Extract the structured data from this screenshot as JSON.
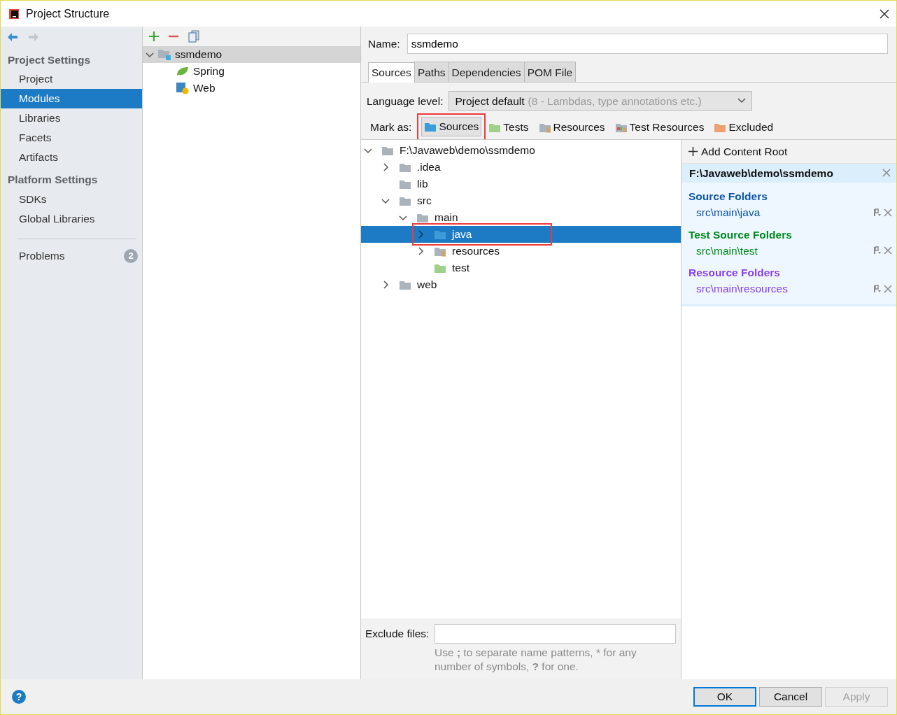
{
  "window": {
    "title": "Project Structure"
  },
  "nav": {
    "back": {
      "disabled": false
    },
    "forward": {
      "disabled": true
    }
  },
  "sidebar": {
    "sections": [
      {
        "heading": "Project Settings",
        "items": [
          {
            "label": "Project",
            "selected": false
          },
          {
            "label": "Modules",
            "selected": true
          },
          {
            "label": "Libraries",
            "selected": false
          },
          {
            "label": "Facets",
            "selected": false
          },
          {
            "label": "Artifacts",
            "selected": false
          }
        ]
      },
      {
        "heading": "Platform Settings",
        "items": [
          {
            "label": "SDKs",
            "selected": false
          },
          {
            "label": "Global Libraries",
            "selected": false
          }
        ]
      }
    ],
    "problems": {
      "label": "Problems",
      "count": "2"
    }
  },
  "modules": {
    "tree": [
      {
        "label": "ssmdemo",
        "kind": "module",
        "expanded": true,
        "selected": true,
        "children": [
          {
            "label": "Spring",
            "kind": "spring",
            "selected": false
          },
          {
            "label": "Web",
            "kind": "web",
            "selected": false
          }
        ]
      }
    ]
  },
  "name_field": {
    "label": "Name:",
    "value": "ssmdemo"
  },
  "tabs": [
    {
      "label": "Sources",
      "selected": true
    },
    {
      "label": "Paths",
      "selected": false
    },
    {
      "label": "Dependencies",
      "selected": false
    },
    {
      "label": "POM File",
      "selected": false
    }
  ],
  "language_level": {
    "label": "Language level:",
    "value": "Project default",
    "detail": "(8 - Lambdas, type annotations etc.)"
  },
  "mark_as": {
    "label": "Mark as:",
    "buttons": [
      {
        "label": "Sources",
        "kind": "source",
        "pressed": true,
        "highlighted": true
      },
      {
        "label": "Tests",
        "kind": "test",
        "pressed": false,
        "highlighted": false
      },
      {
        "label": "Resources",
        "kind": "resources",
        "pressed": false,
        "highlighted": false
      },
      {
        "label": "Test Resources",
        "kind": "test-resources",
        "pressed": false,
        "highlighted": false
      },
      {
        "label": "Excluded",
        "kind": "excluded",
        "pressed": false,
        "highlighted": false
      }
    ]
  },
  "folder_tree": [
    {
      "label": "F:\\Javaweb\\demo\\ssmdemo",
      "kind": "plain",
      "expanded": true,
      "selected": false,
      "highlighted": false,
      "children": [
        {
          "label": ".idea",
          "kind": "plain",
          "expanded": false,
          "selected": false,
          "highlighted": false
        },
        {
          "label": "lib",
          "kind": "plain",
          "selected": false,
          "highlighted": false
        },
        {
          "label": "src",
          "kind": "plain",
          "expanded": true,
          "selected": false,
          "highlighted": false,
          "children": [
            {
              "label": "main",
              "kind": "plain",
              "expanded": true,
              "selected": false,
              "highlighted": false,
              "children": [
                {
                  "label": "java",
                  "kind": "source",
                  "expanded": false,
                  "selected": true,
                  "highlighted": true
                },
                {
                  "label": "resources",
                  "kind": "resources",
                  "expanded": false,
                  "selected": false,
                  "highlighted": false
                },
                {
                  "label": "test",
                  "kind": "test",
                  "selected": false,
                  "highlighted": false
                }
              ]
            }
          ]
        },
        {
          "label": "web",
          "kind": "plain",
          "expanded": false,
          "selected": false,
          "highlighted": false
        }
      ]
    }
  ],
  "content_root": {
    "add_label": "Add Content Root",
    "path": "F:\\Javaweb\\demo\\ssmdemo",
    "groups": [
      {
        "title": "Source Folders",
        "color": "#0d56a6",
        "folders": [
          "src\\main\\java"
        ]
      },
      {
        "title": "Test Source Folders",
        "color": "#008a1e",
        "folders": [
          "src\\main\\test"
        ]
      },
      {
        "title": "Resource Folders",
        "color": "#8a3ff0",
        "folders": [
          "src\\main\\resources"
        ]
      }
    ]
  },
  "exclude_files": {
    "label": "Exclude files:",
    "hint": "Use **;** to separate name patterns, * for any number of symbols, **?** for one."
  },
  "help": "?",
  "buttons": [
    {
      "label": "OK",
      "default": true,
      "disabled": false
    },
    {
      "label": "Cancel",
      "default": false,
      "disabled": false
    },
    {
      "label": "Apply",
      "default": false,
      "disabled": true
    }
  ]
}
